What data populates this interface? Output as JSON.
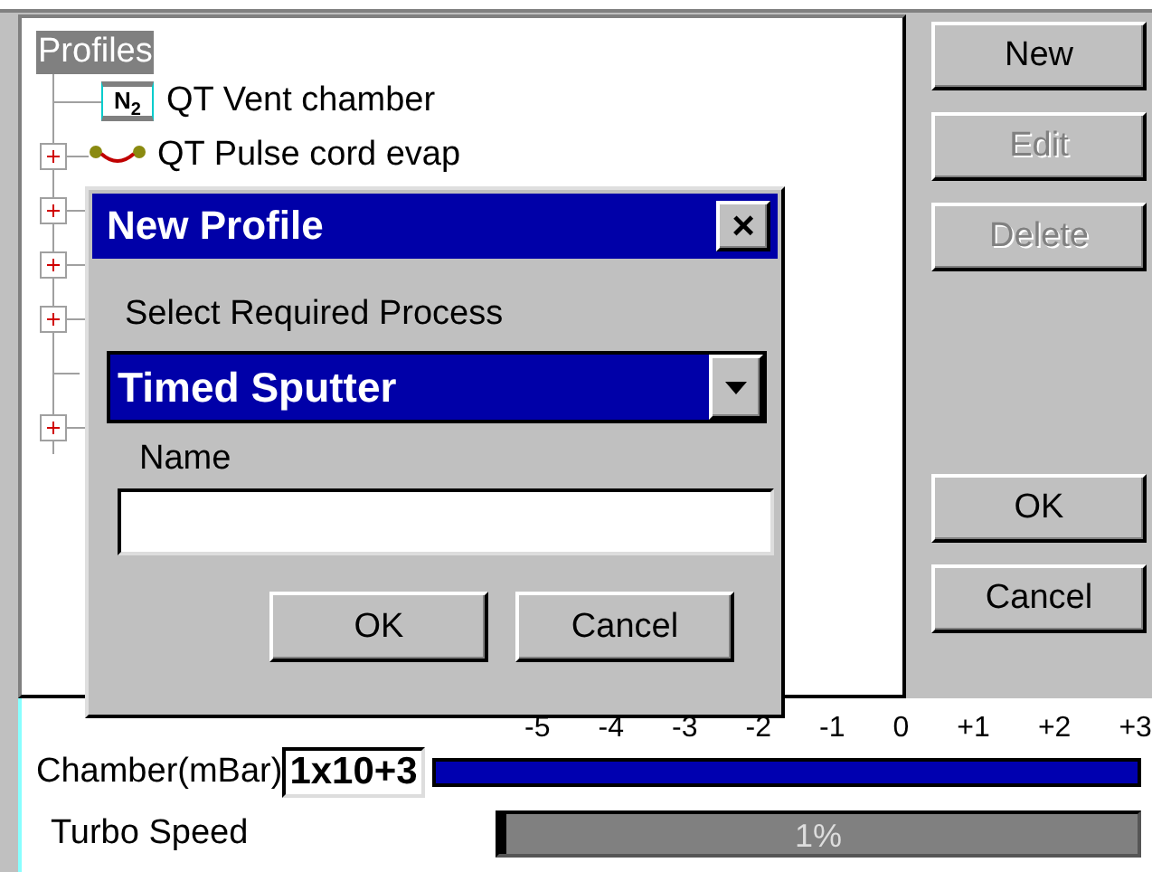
{
  "tree": {
    "root": {
      "label": "Profiles",
      "selected": true
    },
    "items": [
      {
        "kind": "gas",
        "label": "QT Vent chamber",
        "icon_text": "N$_{2}$"
      },
      {
        "kind": "evap",
        "label": "QT Pulse cord evap",
        "expanded": false
      },
      {
        "kind": "hidden",
        "expanded": false
      },
      {
        "kind": "hidden",
        "expanded": false
      },
      {
        "kind": "hidden",
        "expanded": false
      },
      {
        "kind": "hidden"
      },
      {
        "kind": "hidden",
        "expanded": false
      }
    ]
  },
  "side_buttons": [
    {
      "label": "New",
      "disabled": false,
      "kind": "top"
    },
    {
      "label": "Edit",
      "disabled": true,
      "kind": "top"
    },
    {
      "label": "Delete",
      "disabled": true,
      "kind": "top"
    },
    {
      "label": "OK",
      "disabled": false,
      "kind": "bottom"
    },
    {
      "label": "Cancel",
      "disabled": false,
      "kind": "bottom"
    }
  ],
  "gauges": {
    "chamber": {
      "label": "Chamber(mBar)",
      "value": "1x10+3",
      "scale": [
        "-5",
        "-4",
        "-3",
        "-2",
        "-1",
        "0",
        "+1",
        "+2",
        "+3"
      ],
      "level": 1
    },
    "turbo": {
      "label": "Turbo Speed",
      "level": 0.01,
      "reading": "1%"
    }
  },
  "dialog": {
    "title": "New Profile",
    "close": "×",
    "process_label": "Select Required Process",
    "process": "Timed Sputter",
    "name_label": "Name",
    "buttons": [
      "OK",
      "Cancel"
    ]
  }
}
